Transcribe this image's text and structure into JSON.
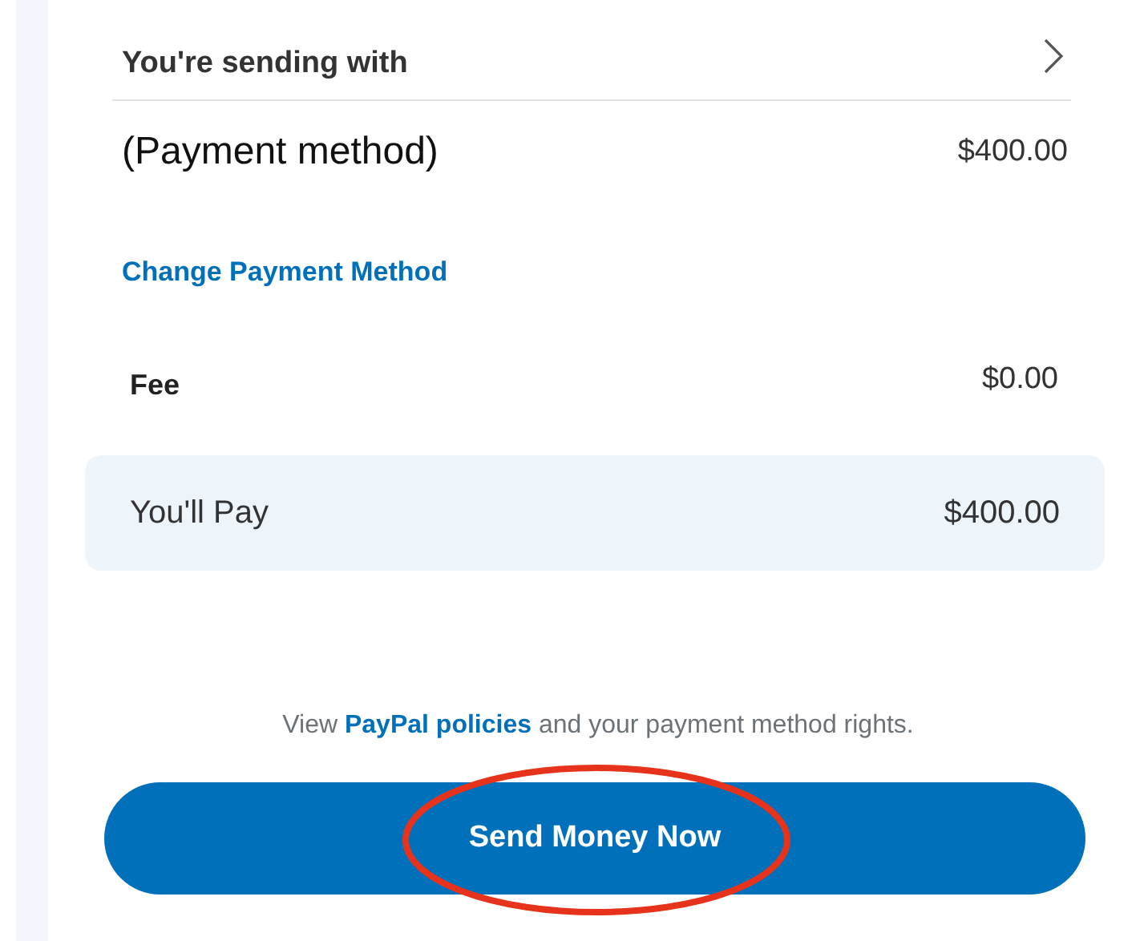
{
  "sending_with": {
    "label": "You're sending with"
  },
  "payment": {
    "method": "(Payment method)",
    "amount": "$400.00"
  },
  "change_link": "Change Payment Method",
  "fee": {
    "label": "Fee",
    "amount": "$0.00"
  },
  "total": {
    "label": "You'll Pay",
    "amount": "$400.00"
  },
  "policy": {
    "before": "View",
    "link": "PayPal policies",
    "after": "and your payment method rights."
  },
  "button": {
    "label": "Send Money Now",
    "highlighted": true
  }
}
